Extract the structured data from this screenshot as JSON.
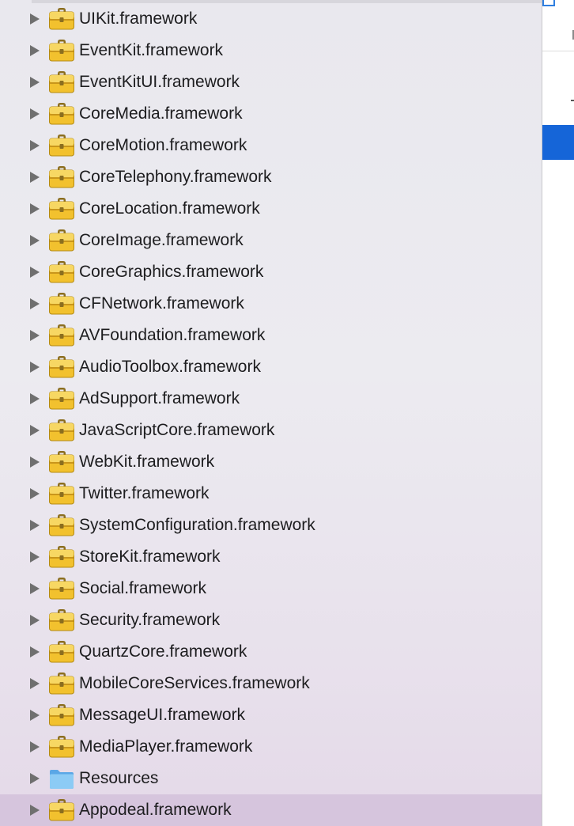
{
  "colors": {
    "folder_yellow": "#f2c12e",
    "folder_blue": "#6fb3ec",
    "selection": "#d6c5dd",
    "accent_blue": "#1565d8"
  },
  "navigator": {
    "items": [
      {
        "label": "UIKit.framework",
        "icon": "framework-icon"
      },
      {
        "label": "EventKit.framework",
        "icon": "framework-icon"
      },
      {
        "label": "EventKitUI.framework",
        "icon": "framework-icon"
      },
      {
        "label": "CoreMedia.framework",
        "icon": "framework-icon"
      },
      {
        "label": "CoreMotion.framework",
        "icon": "framework-icon"
      },
      {
        "label": "CoreTelephony.framework",
        "icon": "framework-icon"
      },
      {
        "label": "CoreLocation.framework",
        "icon": "framework-icon"
      },
      {
        "label": "CoreImage.framework",
        "icon": "framework-icon"
      },
      {
        "label": "CoreGraphics.framework",
        "icon": "framework-icon"
      },
      {
        "label": "CFNetwork.framework",
        "icon": "framework-icon"
      },
      {
        "label": "AVFoundation.framework",
        "icon": "framework-icon"
      },
      {
        "label": "AudioToolbox.framework",
        "icon": "framework-icon"
      },
      {
        "label": "AdSupport.framework",
        "icon": "framework-icon"
      },
      {
        "label": "JavaScriptCore.framework",
        "icon": "framework-icon"
      },
      {
        "label": "WebKit.framework",
        "icon": "framework-icon"
      },
      {
        "label": "Twitter.framework",
        "icon": "framework-icon"
      },
      {
        "label": "SystemConfiguration.framework",
        "icon": "framework-icon"
      },
      {
        "label": "StoreKit.framework",
        "icon": "framework-icon"
      },
      {
        "label": "Social.framework",
        "icon": "framework-icon"
      },
      {
        "label": "Security.framework",
        "icon": "framework-icon"
      },
      {
        "label": "QuartzCore.framework",
        "icon": "framework-icon"
      },
      {
        "label": "MobileCoreServices.framework",
        "icon": "framework-icon"
      },
      {
        "label": "MessageUI.framework",
        "icon": "framework-icon"
      },
      {
        "label": "MediaPlayer.framework",
        "icon": "framework-icon"
      },
      {
        "label": "Resources",
        "icon": "folder-icon"
      },
      {
        "label": "Appodeal.framework",
        "icon": "framework-icon",
        "selected": true
      }
    ]
  }
}
